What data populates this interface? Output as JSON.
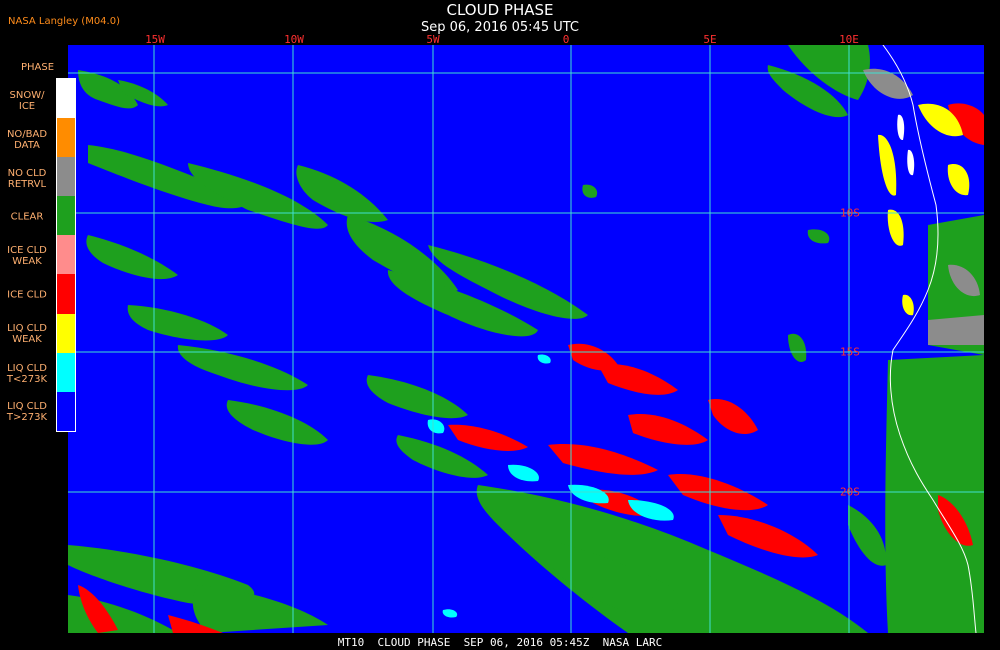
{
  "header": {
    "source": "NASA Langley (M04.0)",
    "title": "CLOUD PHASE",
    "subtitle": "Sep 06, 2016 05:45 UTC"
  },
  "footer": {
    "text": "MT10  CLOUD PHASE  SEP 06, 2016 05:45Z  NASA LARC"
  },
  "map": {
    "lon_labels": [
      "15W",
      "10W",
      "5W",
      "0",
      "5E",
      "10E"
    ],
    "lat_labels": [
      "10S",
      "15S",
      "20S"
    ],
    "ocean_color": "#0000ff",
    "grid_color": "#40e0d0",
    "coast_color": "#ffffff"
  },
  "legend": {
    "title": "PHASE",
    "items": [
      {
        "label": [
          "SNOW/",
          "ICE"
        ],
        "color": "#ffffff"
      },
      {
        "label": [
          "NO/BAD",
          "DATA"
        ],
        "color": "#ff8c00"
      },
      {
        "label": [
          "NO CLD",
          "RETRVL"
        ],
        "color": "#8c8c8c"
      },
      {
        "label": [
          "CLEAR"
        ],
        "color": "#1ea01e"
      },
      {
        "label": [
          "ICE CLD",
          "WEAK"
        ],
        "color": "#ff8c8c"
      },
      {
        "label": [
          "ICE CLD"
        ],
        "color": "#ff0000"
      },
      {
        "label": [
          "LIQ CLD",
          "WEAK"
        ],
        "color": "#ffff00"
      },
      {
        "label": [
          "LIQ CLD",
          "T<273K"
        ],
        "color": "#00ffff"
      },
      {
        "label": [
          "LIQ CLD",
          "T>273K"
        ],
        "color": "#0000ff"
      }
    ]
  }
}
